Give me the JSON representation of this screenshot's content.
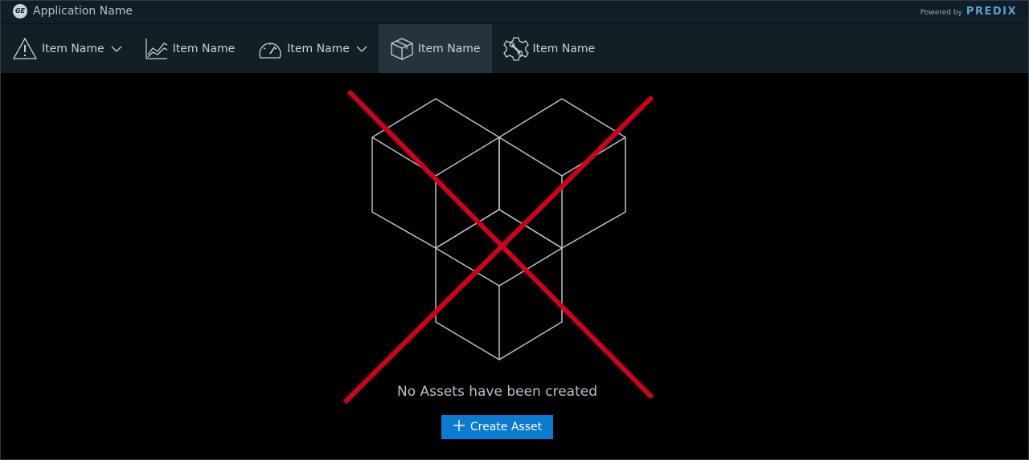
{
  "titlebar": {
    "logo_text": "GE",
    "app_name": "Application Name",
    "powered_by": "Powered by",
    "brand": "PREDIX"
  },
  "nav": {
    "items": [
      {
        "label": "Item Name",
        "icon": "alert-triangle-icon",
        "has_dropdown": true
      },
      {
        "label": "Item Name",
        "icon": "line-chart-icon",
        "has_dropdown": false
      },
      {
        "label": "Item Name",
        "icon": "gauge-icon",
        "has_dropdown": true
      },
      {
        "label": "Item Name",
        "icon": "box-icon",
        "has_dropdown": false,
        "active": true
      },
      {
        "label": "Item Name",
        "icon": "gear-wrench-icon",
        "has_dropdown": false
      }
    ]
  },
  "empty_state": {
    "illustration": "stacked-cubes-icon",
    "overlay": "red-x-icon",
    "message": "No Assets have been created",
    "button_label": "Create Asset",
    "button_icon": "plus-icon"
  },
  "colors": {
    "accent": "#0a7bd0",
    "cross": "#d0021b",
    "background": "#000000",
    "navbar": "#141e25",
    "titlebar": "#0f1e28"
  }
}
